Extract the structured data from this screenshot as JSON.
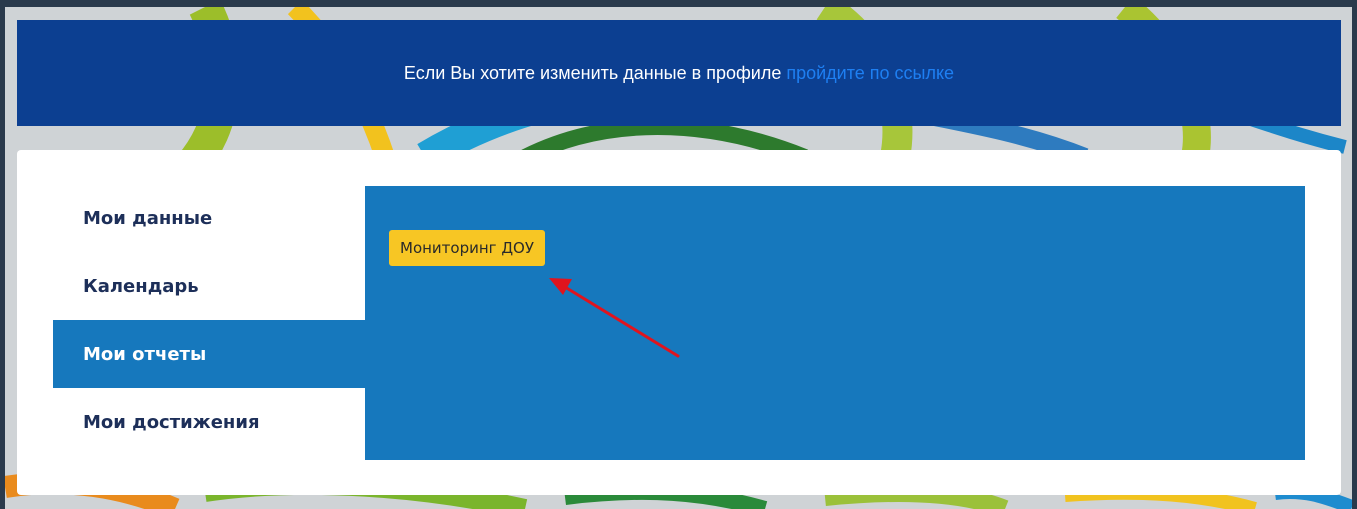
{
  "banner": {
    "text": "Если Вы хотите изменить данные в профиле",
    "link_text": "пройдите по ссылке"
  },
  "side_nav": {
    "items": [
      {
        "label": "Мои данные",
        "active": false
      },
      {
        "label": "Календарь",
        "active": false
      },
      {
        "label": "Мои отчеты",
        "active": true
      },
      {
        "label": "Мои достижения",
        "active": false
      }
    ]
  },
  "content": {
    "button_label": "Мониторинг ДОУ"
  },
  "colors": {
    "banner_bg": "#0c3f91",
    "link": "#1e7ff2",
    "accent_blue": "#1678bd",
    "button_yellow": "#f7c624",
    "nav_text": "#1d2f59",
    "annotation_arrow": "#e0141e"
  }
}
